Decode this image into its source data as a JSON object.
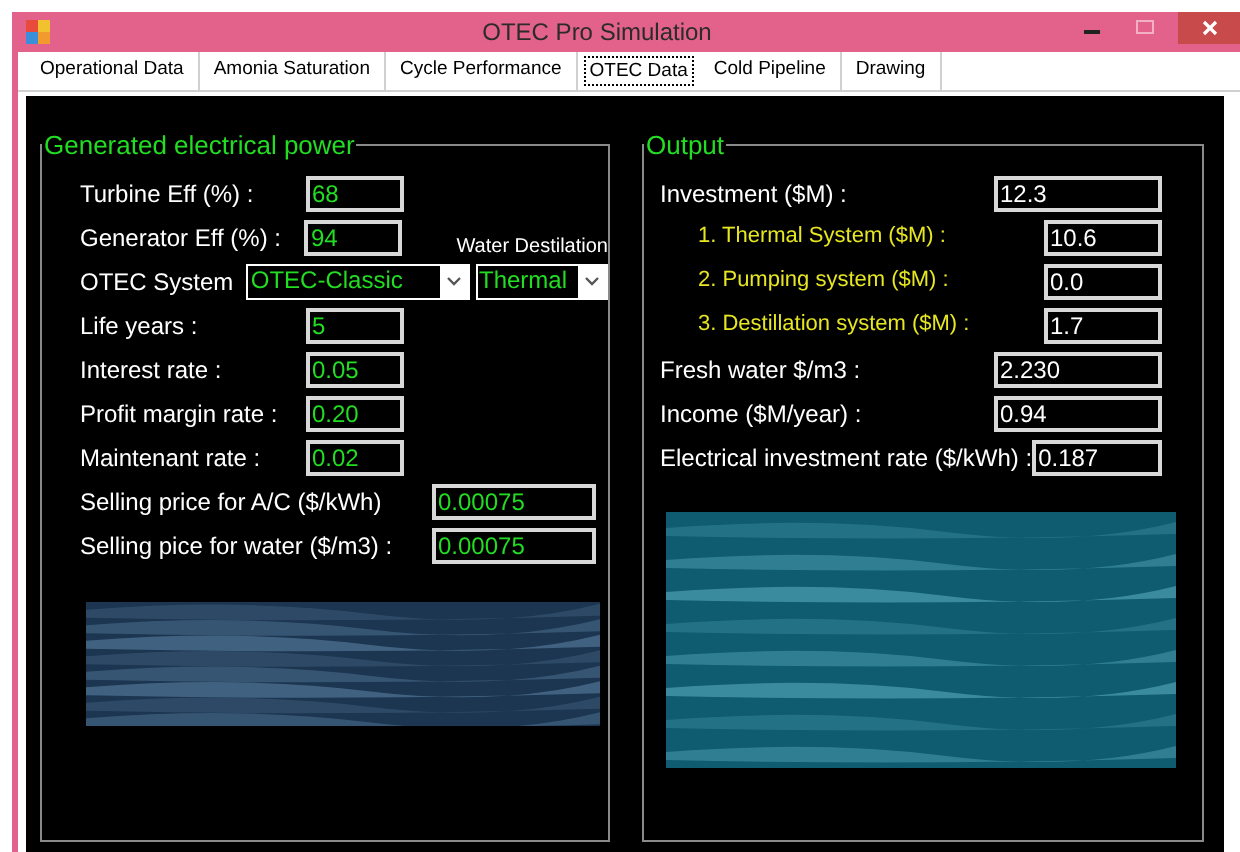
{
  "window": {
    "title": "OTEC Pro Simulation"
  },
  "tabs": [
    {
      "label": "Operational Data",
      "selected": false
    },
    {
      "label": "Amonia Saturation",
      "selected": false
    },
    {
      "label": "Cycle Performance",
      "selected": false
    },
    {
      "label": "OTEC Data",
      "selected": true
    },
    {
      "label": "Cold Pipeline",
      "selected": false
    },
    {
      "label": "Drawing",
      "selected": false
    }
  ],
  "generated_power": {
    "title": "Generated electrical power",
    "fields": [
      {
        "kind": "input",
        "label": "Turbine Eff (%) :",
        "value": "68"
      },
      {
        "kind": "input",
        "label": "Generator Eff (%) :",
        "value": "94"
      },
      {
        "kind": "combo",
        "label": "OTEC System",
        "value": "OTEC-Classic"
      },
      {
        "kind": "input",
        "label": "Life years :",
        "value": "5"
      },
      {
        "kind": "input",
        "label": "Interest rate :",
        "value": "0.05"
      },
      {
        "kind": "input",
        "label": "Profit margin rate :",
        "value": "0.20"
      },
      {
        "kind": "input",
        "label": "Maintenant rate :",
        "value": "0.02"
      },
      {
        "kind": "wide",
        "label": "Selling price for A/C ($/kWh)",
        "value": "0.00075"
      },
      {
        "kind": "wide",
        "label": "Selling pice for water ($/m3) :",
        "value": "0.00075"
      }
    ],
    "water_destilation": {
      "label": "Water Destilation",
      "value": "Thermal"
    }
  },
  "output": {
    "title": "Output",
    "fields": [
      {
        "kind": "main",
        "label": "Investment ($M) :",
        "value": "12.3"
      },
      {
        "kind": "sub",
        "label": "1. Thermal System ($M) :",
        "value": "10.6"
      },
      {
        "kind": "sub",
        "label": "2. Pumping system ($M) :",
        "value": "0.0"
      },
      {
        "kind": "sub",
        "label": "3. Destillation system ($M) :",
        "value": "1.7"
      },
      {
        "kind": "main",
        "label": "Fresh water $/m3 :",
        "value": "2.230"
      },
      {
        "kind": "main",
        "label": "Income ($M/year) :",
        "value": "0.94"
      },
      {
        "kind": "main",
        "label": "Electrical investment rate ($/kWh) :",
        "value": "0.187"
      }
    ]
  }
}
